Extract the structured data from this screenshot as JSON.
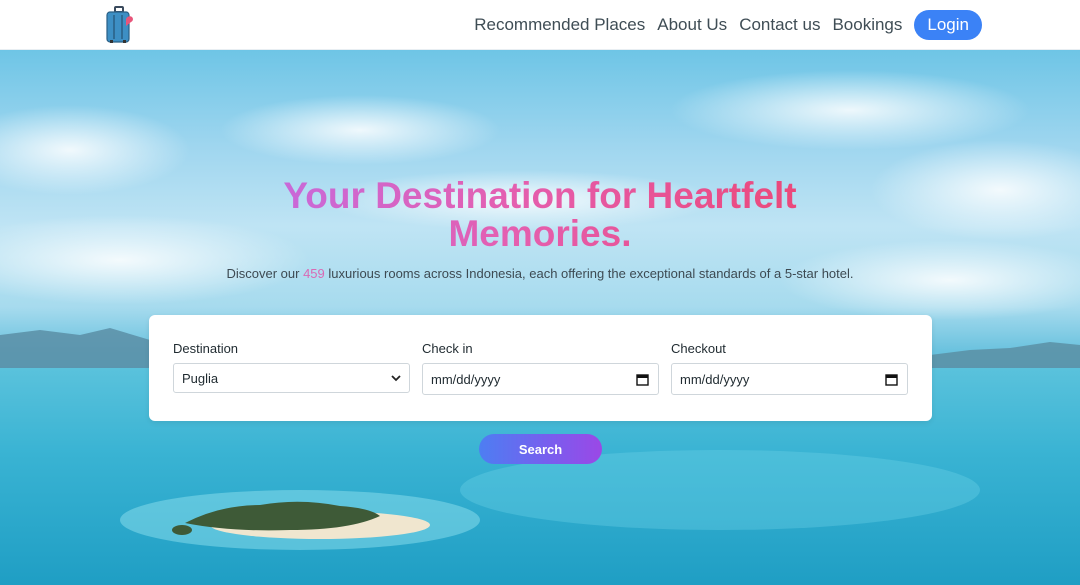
{
  "brand": {
    "logo_icon": "suitcase-icon"
  },
  "nav": {
    "links": [
      "Recommended Places",
      "About Us",
      "Contact us",
      "Bookings"
    ],
    "login_label": "Login"
  },
  "hero": {
    "title": "Your Destination for Heartfelt Memories.",
    "subtitle_prefix": "Discover our ",
    "room_count": "459",
    "subtitle_suffix": " luxurious rooms across Indonesia, each offering the exceptional standards of a 5-star hotel."
  },
  "search": {
    "destination_label": "Destination",
    "destination_value": "Puglia",
    "checkin_label": "Check in",
    "checkin_placeholder": "mm/dd/yyyy",
    "checkout_label": "Checkout",
    "checkout_placeholder": "mm/dd/yyyy",
    "button_label": "Search"
  },
  "colors": {
    "accent": "#3b82f6",
    "title_gradient_start": "#c36be0",
    "title_gradient_end": "#ec4573",
    "count_highlight": "#d96bb5"
  }
}
